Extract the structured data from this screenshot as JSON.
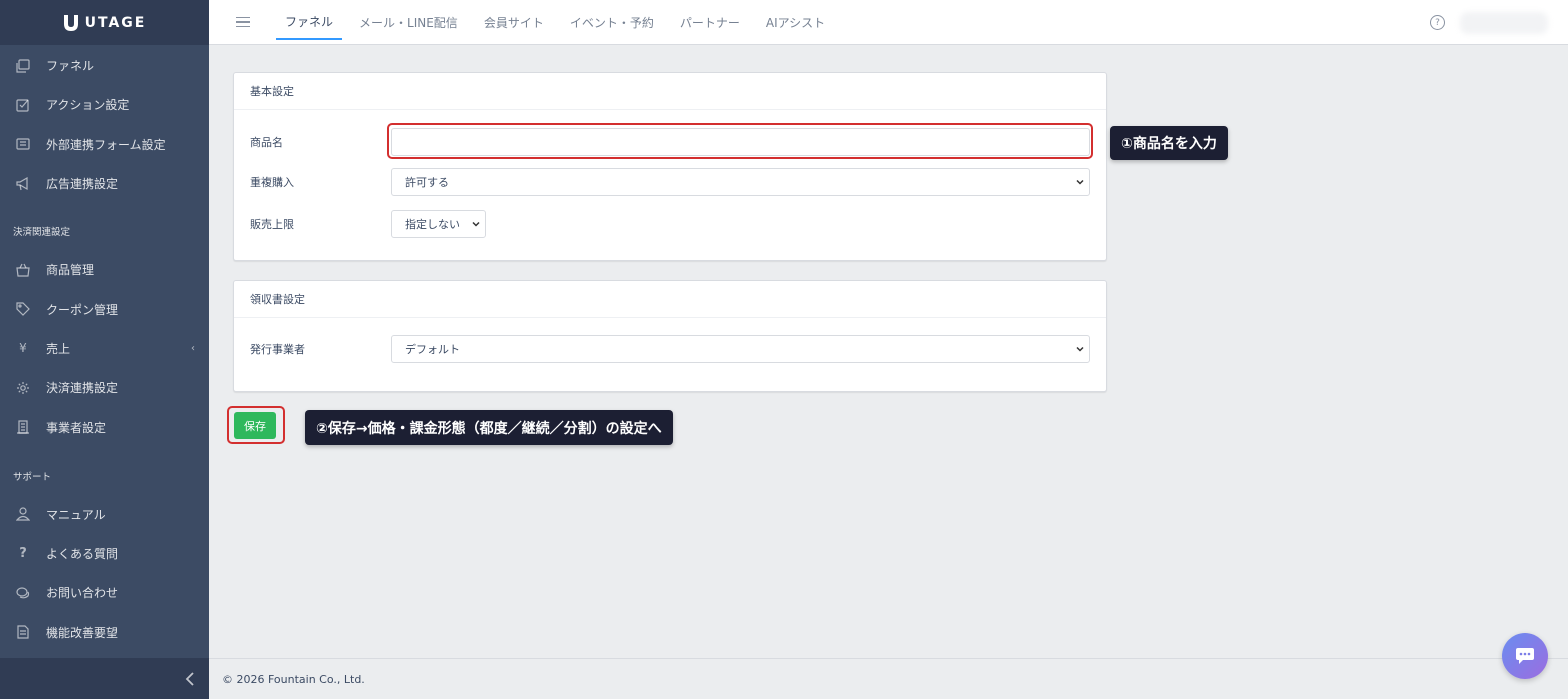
{
  "brand": {
    "name": "UTAGE"
  },
  "sidebar": {
    "items_top": [
      {
        "label": "ファネル",
        "icon": "funnel-icon"
      },
      {
        "label": "アクション設定",
        "icon": "action-icon"
      },
      {
        "label": "外部連携フォーム設定",
        "icon": "form-icon"
      },
      {
        "label": "広告連携設定",
        "icon": "megaphone-icon"
      }
    ],
    "section_payment": "決済関連設定",
    "items_payment": [
      {
        "label": "商品管理",
        "icon": "basket-icon"
      },
      {
        "label": "クーポン管理",
        "icon": "tag-icon"
      },
      {
        "label": "売上",
        "icon": "yen-icon",
        "glyph": "¥"
      },
      {
        "label": "決済連携設定",
        "icon": "gear-icon"
      },
      {
        "label": "事業者設定",
        "icon": "building-icon"
      }
    ],
    "section_support": "サポート",
    "items_support": [
      {
        "label": "マニュアル",
        "icon": "person-icon"
      },
      {
        "label": "よくある質問",
        "icon": "question-icon",
        "glyph": "?"
      },
      {
        "label": "お問い合わせ",
        "icon": "chat-bubble-icon"
      },
      {
        "label": "機能改善要望",
        "icon": "document-icon"
      }
    ]
  },
  "header": {
    "tabs": [
      {
        "label": "ファネル",
        "active": true
      },
      {
        "label": "メール・LINE配信",
        "active": false
      },
      {
        "label": "会員サイト",
        "active": false
      },
      {
        "label": "イベント・予約",
        "active": false
      },
      {
        "label": "パートナー",
        "active": false
      },
      {
        "label": "AIアシスト",
        "active": false
      }
    ],
    "help_glyph": "?"
  },
  "basic_settings": {
    "title": "基本設定",
    "product_name_label": "商品名",
    "product_name_value": "",
    "duplicate_purchase_label": "重複購入",
    "duplicate_purchase_value": "許可する",
    "sales_limit_label": "販売上限",
    "sales_limit_value": "指定しない"
  },
  "receipt_settings": {
    "title": "領収書設定",
    "issuer_label": "発行事業者",
    "issuer_value": "デフォルト"
  },
  "save_button": {
    "label": "保存"
  },
  "callouts": {
    "step1": "①商品名を入力",
    "step2": "②保存→価格・課金形態（都度／継続／分割）の設定へ"
  },
  "footer": {
    "copyright": "© 2026 Fountain Co., Ltd."
  },
  "colors": {
    "sidebar_bg": "#3c4b64",
    "accent_blue": "#3399ff",
    "highlight_red": "#d32f2f",
    "save_green": "#2eb85c",
    "callout_bg": "#1c1f33"
  }
}
